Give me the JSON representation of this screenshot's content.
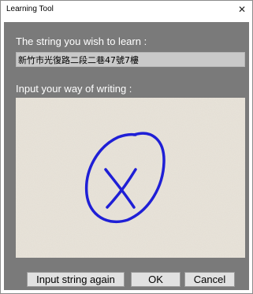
{
  "window": {
    "title": "Learning Tool"
  },
  "dialog": {
    "string_label": "The string you wish to learn :",
    "string_value": "新竹市光復路二段二巷47號7樓",
    "writing_label": "Input your way of writing :"
  },
  "buttons": {
    "input_again": "Input string again",
    "ok": "OK",
    "cancel": "Cancel"
  },
  "icons": {
    "close": "close-icon"
  },
  "colors": {
    "dialog_background": "#7a7a7a",
    "ink": "#1f1fd6",
    "canvas": "#e9e4da"
  }
}
